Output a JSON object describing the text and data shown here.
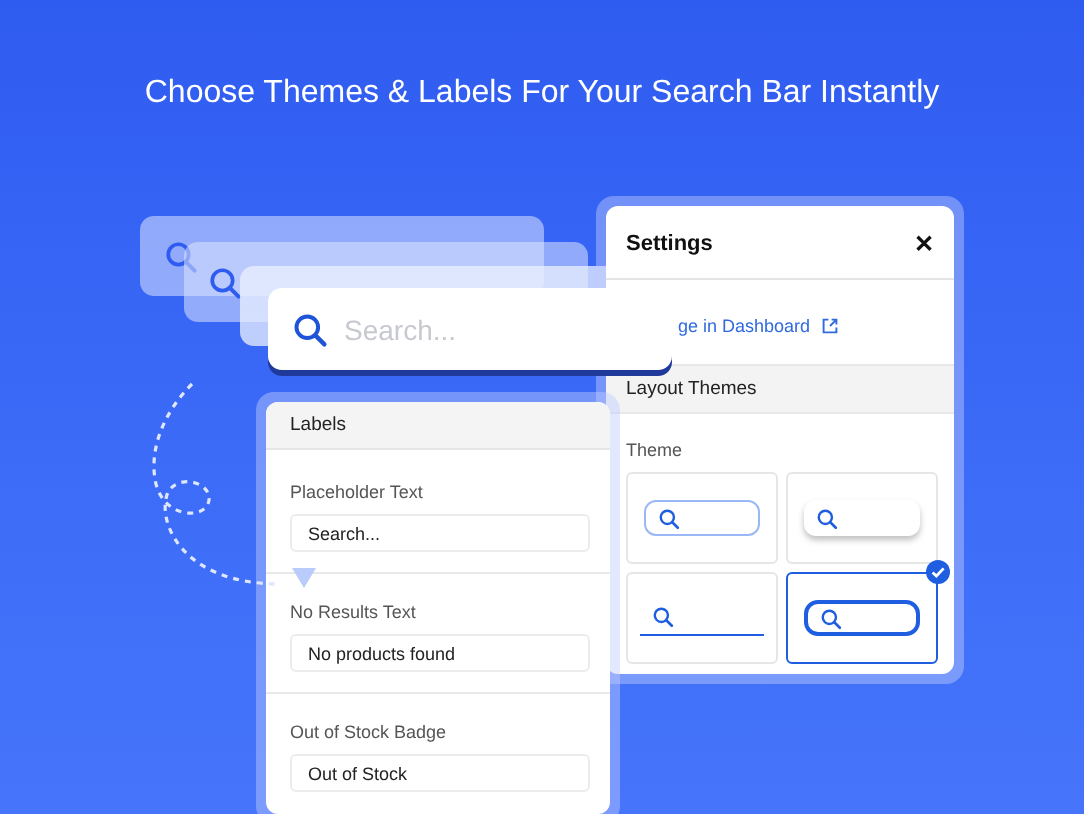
{
  "headline": "Choose Themes & Labels For Your Search Bar Instantly",
  "search_bar": {
    "placeholder": "Search..."
  },
  "settings": {
    "title": "Settings",
    "close": "✕",
    "link": "ge in Dashboard",
    "section": "Layout Themes",
    "theme_label": "Theme",
    "themes": [
      {
        "kind": "outlined",
        "selected": false
      },
      {
        "kind": "shadow",
        "selected": false
      },
      {
        "kind": "underline",
        "selected": false
      },
      {
        "kind": "bold",
        "selected": true
      }
    ]
  },
  "labels": {
    "title": "Labels",
    "fields": [
      {
        "label": "Placeholder Text",
        "value": "Search..."
      },
      {
        "label": "No Results Text",
        "value": "No products found"
      },
      {
        "label": "Out of Stock Badge",
        "value": "Out of Stock"
      }
    ]
  }
}
